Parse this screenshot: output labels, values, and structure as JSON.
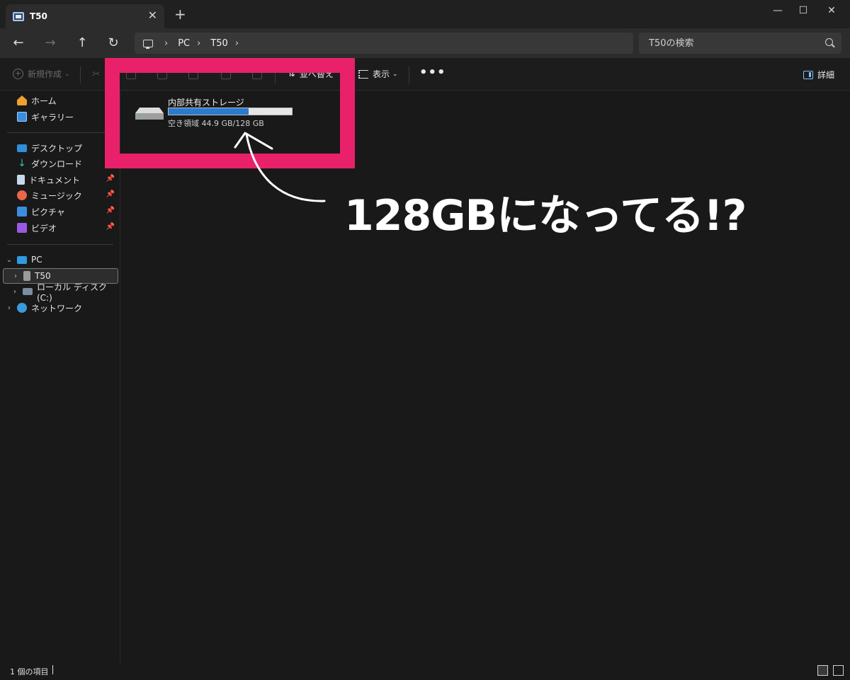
{
  "window": {
    "tab_title": "T50",
    "new_tab": "+",
    "tab_close": "✕",
    "minimize": "—",
    "maximize": "☐",
    "close": "✕"
  },
  "nav": {
    "back": "←",
    "forward": "→",
    "up": "↑",
    "refresh": "↻",
    "breadcrumbs": [
      "PC",
      "T50"
    ],
    "sep": "›",
    "search_placeholder": "T50の検索"
  },
  "commands": {
    "new": "新規作成",
    "sort": "並べ替え",
    "view": "表示",
    "more": "•••",
    "details": "詳細"
  },
  "sidebar": {
    "quick": [
      {
        "label": "ホーム"
      },
      {
        "label": "ギャラリー"
      }
    ],
    "pinned": [
      {
        "label": "デスクトップ"
      },
      {
        "label": "ダウンロード"
      },
      {
        "label": "ドキュメント"
      },
      {
        "label": "ミュージック"
      },
      {
        "label": "ピクチャ"
      },
      {
        "label": "ビデオ"
      }
    ],
    "tree": {
      "pc": "PC",
      "t50": "T50",
      "local_disk": "ローカル ディスク (C:)",
      "network": "ネットワーク"
    }
  },
  "drive": {
    "name": "内部共有ストレージ",
    "space_text": "空き領域 44.9 GB/128 GB",
    "used_fraction": 0.65
  },
  "annotation": {
    "text": "128GBになってる!?"
  },
  "status": {
    "item_count": "1 個の項目"
  },
  "colors": {
    "highlight": "#e8216a",
    "drive_bar_fill": "#2a7ad0",
    "accent": "#7fc3ff"
  }
}
